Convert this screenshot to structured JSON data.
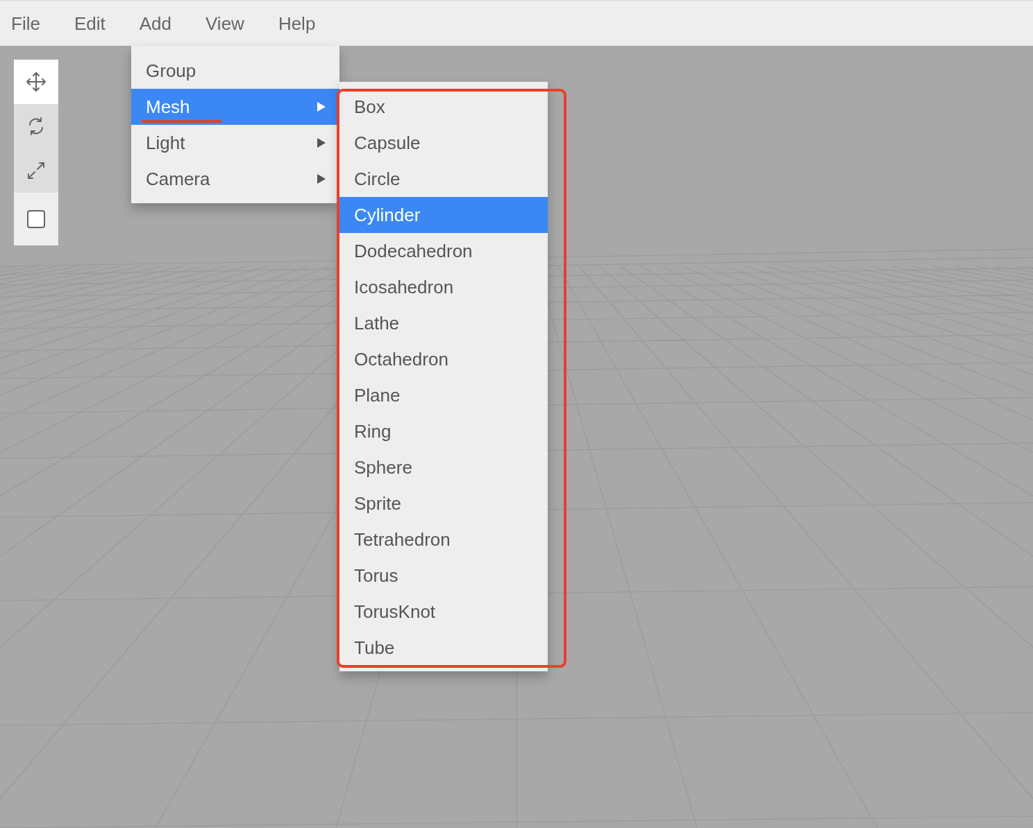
{
  "menubar": [
    {
      "label": "File"
    },
    {
      "label": "Edit"
    },
    {
      "label": "Add"
    },
    {
      "label": "View"
    },
    {
      "label": "Help"
    }
  ],
  "toolbar": {
    "tools": [
      {
        "kind": "translate",
        "selected": true
      },
      {
        "kind": "rotate",
        "selected": false
      },
      {
        "kind": "scale",
        "selected": false
      }
    ],
    "local_toggle": {
      "checked": false
    }
  },
  "add_menu": {
    "items": [
      {
        "label": "Group",
        "submenu": false,
        "selected": false
      },
      {
        "label": "Mesh",
        "submenu": true,
        "selected": true
      },
      {
        "label": "Light",
        "submenu": true,
        "selected": false
      },
      {
        "label": "Camera",
        "submenu": true,
        "selected": false
      }
    ]
  },
  "mesh_submenu": {
    "items": [
      {
        "label": "Box",
        "selected": false
      },
      {
        "label": "Capsule",
        "selected": false
      },
      {
        "label": "Circle",
        "selected": false
      },
      {
        "label": "Cylinder",
        "selected": true
      },
      {
        "label": "Dodecahedron",
        "selected": false
      },
      {
        "label": "Icosahedron",
        "selected": false
      },
      {
        "label": "Lathe",
        "selected": false
      },
      {
        "label": "Octahedron",
        "selected": false
      },
      {
        "label": "Plane",
        "selected": false
      },
      {
        "label": "Ring",
        "selected": false
      },
      {
        "label": "Sphere",
        "selected": false
      },
      {
        "label": "Sprite",
        "selected": false
      },
      {
        "label": "Tetrahedron",
        "selected": false
      },
      {
        "label": "Torus",
        "selected": false
      },
      {
        "label": "TorusKnot",
        "selected": false
      },
      {
        "label": "Tube",
        "selected": false
      }
    ]
  }
}
